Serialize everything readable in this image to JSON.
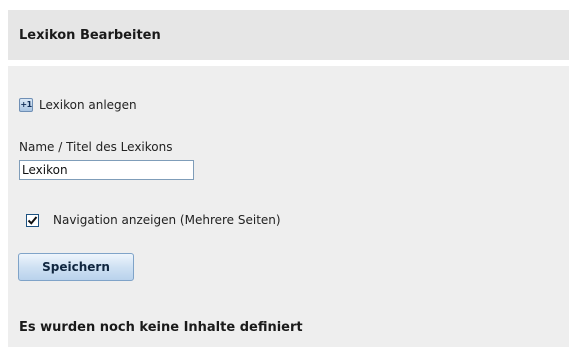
{
  "header": {
    "title": "Lexikon Bearbeiten"
  },
  "actions": {
    "add_icon_text": "+1",
    "add_label": "Lexikon anlegen"
  },
  "form": {
    "name_label": "Name / Titel des Lexikons",
    "name_value": "Lexikon",
    "navigation_label": "Navigation anzeigen (Mehrere Seiten)",
    "navigation_checked": true,
    "save_label": "Speichern"
  },
  "status": {
    "empty_message": "Es wurden noch keine Inhalte definiert"
  },
  "colors": {
    "header_bg": "#e6e6e6",
    "panel_bg": "#eeeeee",
    "button_border": "#7fa3c8"
  }
}
